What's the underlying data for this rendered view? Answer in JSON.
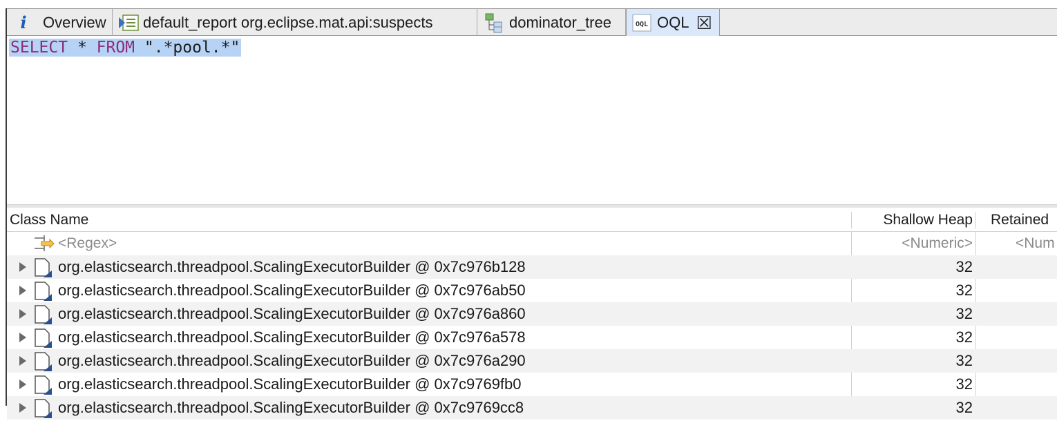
{
  "tabs": [
    {
      "label": "Overview",
      "icon": "info-icon"
    },
    {
      "label": "default_report  org.eclipse.mat.api:suspects",
      "icon": "report-icon"
    },
    {
      "label": "dominator_tree",
      "icon": "tree-icon"
    },
    {
      "label": "OQL",
      "icon": "oql-icon",
      "active": true,
      "close": "close-icon"
    }
  ],
  "editor": {
    "kw_select": "SELECT",
    "star": " * ",
    "kw_from": "FROM",
    "string": " \".*pool.*\""
  },
  "table": {
    "columns": [
      "Class Name",
      "Shallow Heap",
      "Retained"
    ],
    "filter": {
      "regex": "<Regex>",
      "numeric": "<Numeric>",
      "numeric_partial": "<Num"
    },
    "rows": [
      {
        "name": "org.elasticsearch.threadpool.ScalingExecutorBuilder @ 0x7c976b128",
        "shallow": "32"
      },
      {
        "name": "org.elasticsearch.threadpool.ScalingExecutorBuilder @ 0x7c976ab50",
        "shallow": "32"
      },
      {
        "name": "org.elasticsearch.threadpool.ScalingExecutorBuilder @ 0x7c976a860",
        "shallow": "32"
      },
      {
        "name": "org.elasticsearch.threadpool.ScalingExecutorBuilder @ 0x7c976a578",
        "shallow": "32"
      },
      {
        "name": "org.elasticsearch.threadpool.ScalingExecutorBuilder @ 0x7c976a290",
        "shallow": "32"
      },
      {
        "name": "org.elasticsearch.threadpool.ScalingExecutorBuilder @ 0x7c9769fb0",
        "shallow": "32"
      },
      {
        "name": "org.elasticsearch.threadpool.ScalingExecutorBuilder @ 0x7c9769cc8",
        "shallow": "32"
      }
    ]
  },
  "colors": {
    "selection": "#b6d2f5",
    "keyword": "#8a2f76",
    "active_tab": "#dbe8fb"
  }
}
